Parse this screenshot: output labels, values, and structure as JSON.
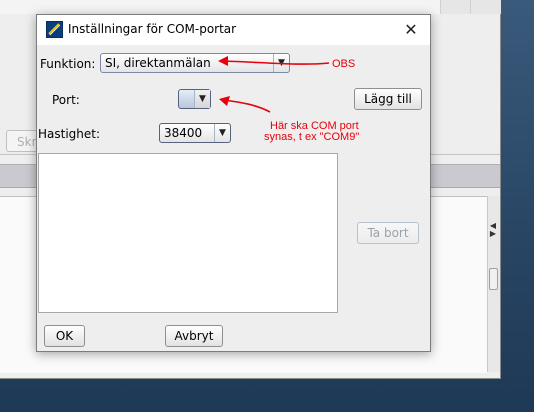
{
  "background_window": {
    "ghost_button_label": "Skr"
  },
  "dialog": {
    "title": "Inställningar för COM-portar",
    "close_glyph": "✕",
    "funktion": {
      "label": "Funktion:",
      "value": "SI, direktanmälan",
      "arrow_glyph": "▼"
    },
    "port": {
      "label": "Port:",
      "value": "",
      "arrow_glyph": "▼"
    },
    "hastighet": {
      "label": "Hastighet:",
      "value": "38400",
      "arrow_glyph": "▼"
    },
    "buttons": {
      "add_label": "Lägg till",
      "remove_label": "Ta bort",
      "ok_label": "OK",
      "cancel_label": "Avbryt"
    },
    "port_list": []
  },
  "annotations": {
    "obs": "OBS",
    "port_note_line1": "Här ska COM port",
    "port_note_line2": "synas, t ex \"COM9\"",
    "color": "#e8000a"
  }
}
